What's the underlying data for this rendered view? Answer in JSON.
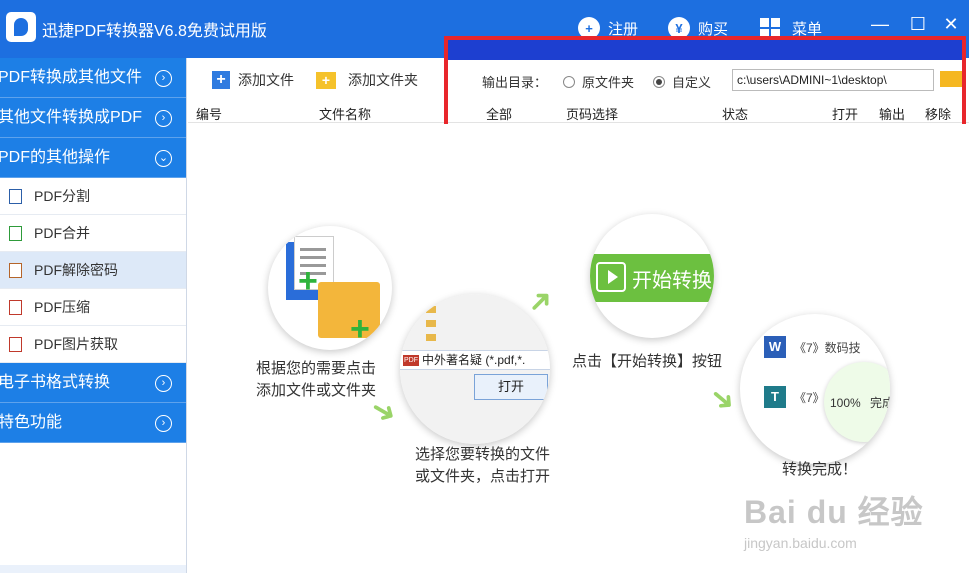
{
  "titlebar": {
    "app_title": "迅捷PDF转换器V6.8免费试用版",
    "register": "注册",
    "buy": "购买",
    "menu": "菜单",
    "register_icon": "user-plus-icon",
    "buy_icon": "yen-icon",
    "menu_icon": "grid-icon",
    "minimize": "—",
    "maximize": "☐",
    "close": "✕"
  },
  "sidebar": {
    "sections": [
      {
        "label": "PDF转换成其他文件",
        "expanded": false
      },
      {
        "label": "其他文件转换成PDF",
        "expanded": false
      },
      {
        "label": "PDF的其他操作",
        "expanded": true
      },
      {
        "label": "电子书格式转换",
        "expanded": false
      },
      {
        "label": "特色功能",
        "expanded": false
      }
    ],
    "items": [
      {
        "label": "PDF分割"
      },
      {
        "label": "PDF合并"
      },
      {
        "label": "PDF解除密码",
        "active": true
      },
      {
        "label": "PDF压缩"
      },
      {
        "label": "PDF图片获取"
      }
    ],
    "chevron_right": "›",
    "chevron_down": "⌄"
  },
  "toolbar": {
    "add_file": "添加文件",
    "add_folder": "添加文件夹",
    "output_dir_label": "输出目录：",
    "radio_original": "原文件夹",
    "radio_custom": "自定义",
    "selected_radio": "custom",
    "output_path": "c:\\users\\ADMINI~1\\desktop\\"
  },
  "table": {
    "columns": [
      "编号",
      "文件名称",
      "全部",
      "页码选择",
      "状态",
      "打开",
      "输出",
      "移除"
    ]
  },
  "guide": {
    "step1": [
      "根据您的需要点击",
      "添加文件或文件夹"
    ],
    "step2": [
      "选择您要转换的文件",
      "或文件夹，点击打开"
    ],
    "step3": "点击【开始转换】按钮",
    "step4": "转换完成！",
    "dialog_file": "中外著名疑",
    "dialog_filter": "(*.pdf,*.",
    "open_button": "打开",
    "start_button": "开始转换",
    "done_item1": "《7》数码技",
    "done_item2": "《7》",
    "done_percent": "100%",
    "done_status": "完成"
  },
  "watermark": {
    "main": "Bai du 经验",
    "sub": "jingyan.baidu.com"
  },
  "colors": {
    "brand_blue": "#1d6fe0",
    "sidebar_blue": "#1d7fe6",
    "highlight_red": "#e8262b",
    "start_green": "#6cc040"
  }
}
